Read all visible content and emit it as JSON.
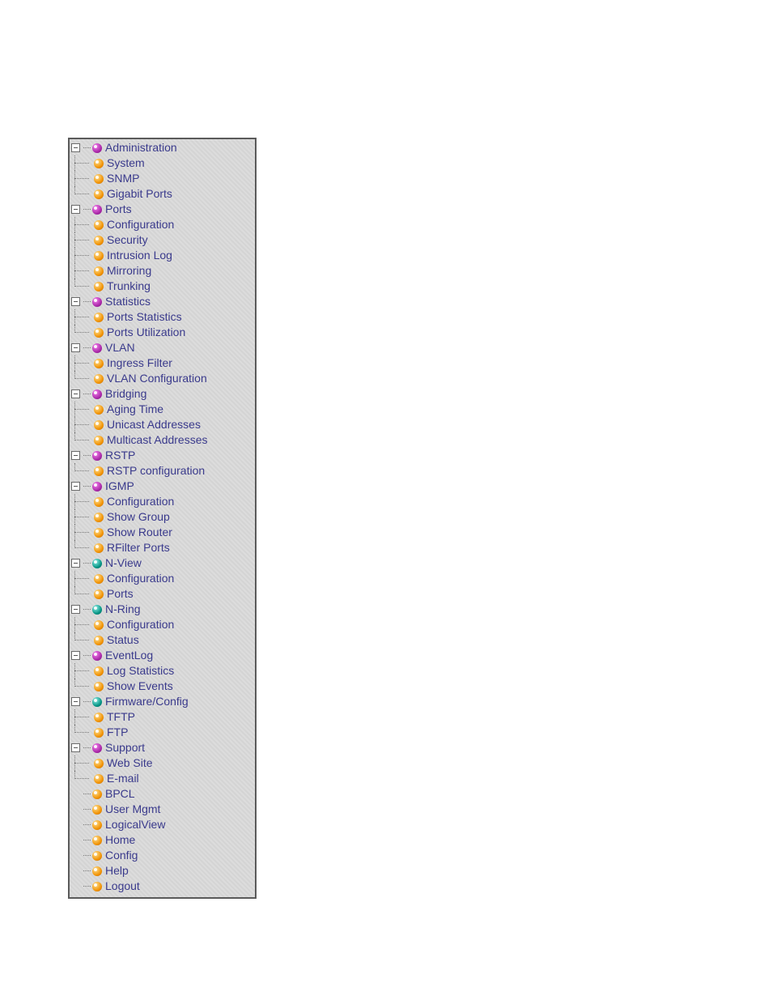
{
  "tree": [
    {
      "label": "Administration",
      "color": "magenta",
      "expandable": true,
      "children": [
        {
          "label": "System",
          "color": "orange"
        },
        {
          "label": "SNMP",
          "color": "orange"
        },
        {
          "label": "Gigabit Ports",
          "color": "orange"
        }
      ]
    },
    {
      "label": "Ports",
      "color": "magenta",
      "expandable": true,
      "children": [
        {
          "label": "Configuration",
          "color": "orange"
        },
        {
          "label": "Security",
          "color": "orange"
        },
        {
          "label": "Intrusion Log",
          "color": "orange"
        },
        {
          "label": "Mirroring",
          "color": "orange"
        },
        {
          "label": "Trunking",
          "color": "orange"
        }
      ]
    },
    {
      "label": "Statistics",
      "color": "magenta",
      "expandable": true,
      "children": [
        {
          "label": "Ports Statistics",
          "color": "orange"
        },
        {
          "label": "Ports Utilization",
          "color": "orange"
        }
      ]
    },
    {
      "label": "VLAN",
      "color": "magenta",
      "expandable": true,
      "children": [
        {
          "label": "Ingress Filter",
          "color": "orange"
        },
        {
          "label": "VLAN Configuration",
          "color": "orange"
        }
      ]
    },
    {
      "label": "Bridging",
      "color": "magenta",
      "expandable": true,
      "children": [
        {
          "label": "Aging Time",
          "color": "orange"
        },
        {
          "label": "Unicast Addresses",
          "color": "orange"
        },
        {
          "label": "Multicast Addresses",
          "color": "orange"
        }
      ]
    },
    {
      "label": "RSTP",
      "color": "magenta",
      "expandable": true,
      "children": [
        {
          "label": "RSTP configuration",
          "color": "orange"
        }
      ]
    },
    {
      "label": "IGMP",
      "color": "magenta",
      "expandable": true,
      "children": [
        {
          "label": "Configuration",
          "color": "orange"
        },
        {
          "label": "Show Group",
          "color": "orange"
        },
        {
          "label": "Show Router",
          "color": "orange"
        },
        {
          "label": "RFilter Ports",
          "color": "orange"
        }
      ]
    },
    {
      "label": "N-View",
      "color": "teal",
      "expandable": true,
      "children": [
        {
          "label": "Configuration",
          "color": "orange"
        },
        {
          "label": "Ports",
          "color": "orange"
        }
      ]
    },
    {
      "label": "N-Ring",
      "color": "teal",
      "expandable": true,
      "children": [
        {
          "label": "Configuration",
          "color": "orange"
        },
        {
          "label": "Status",
          "color": "orange"
        }
      ]
    },
    {
      "label": "EventLog",
      "color": "magenta",
      "expandable": true,
      "children": [
        {
          "label": "Log Statistics",
          "color": "orange"
        },
        {
          "label": "Show Events",
          "color": "orange"
        }
      ]
    },
    {
      "label": "Firmware/Config",
      "color": "teal",
      "expandable": true,
      "children": [
        {
          "label": "TFTP",
          "color": "orange"
        },
        {
          "label": "FTP",
          "color": "orange"
        }
      ]
    },
    {
      "label": "Support",
      "color": "magenta",
      "expandable": true,
      "children": [
        {
          "label": "Web Site",
          "color": "orange"
        },
        {
          "label": "E-mail",
          "color": "orange"
        }
      ]
    },
    {
      "label": "BPCL",
      "color": "orange",
      "expandable": false
    },
    {
      "label": "User Mgmt",
      "color": "orange",
      "expandable": false
    },
    {
      "label": "LogicalView",
      "color": "orange",
      "expandable": false
    },
    {
      "label": "Home",
      "color": "orange",
      "expandable": false
    },
    {
      "label": "Config",
      "color": "orange",
      "expandable": false
    },
    {
      "label": "Help",
      "color": "orange",
      "expandable": false
    },
    {
      "label": "Logout",
      "color": "orange",
      "expandable": false
    }
  ]
}
